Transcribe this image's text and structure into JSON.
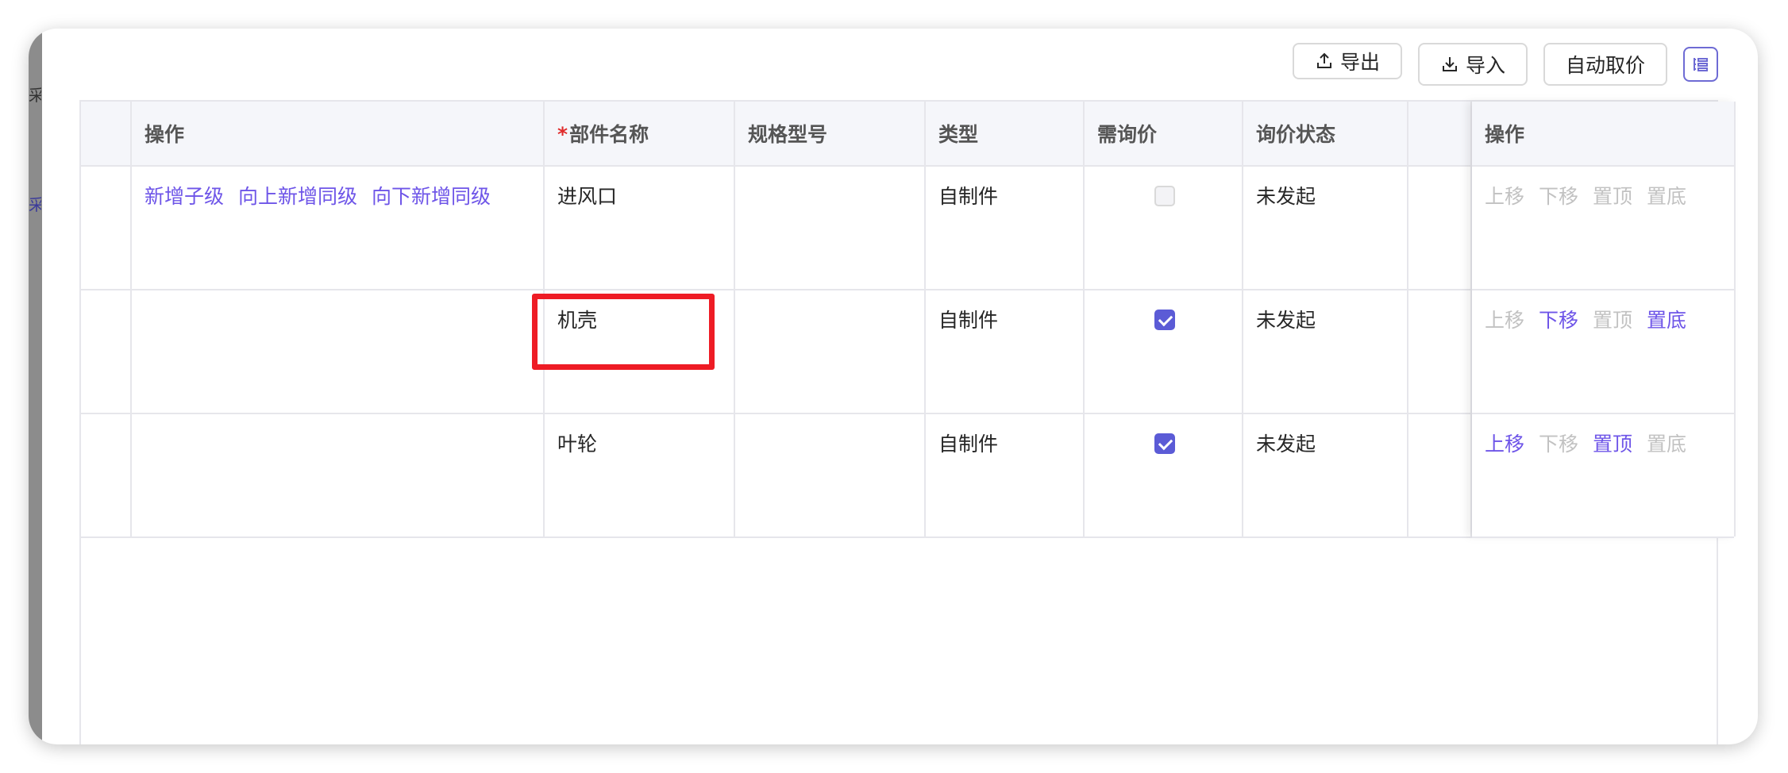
{
  "toolbar": {
    "export_label": "导出",
    "import_label": "导入",
    "auto_price_label": "自动取价"
  },
  "left_fragments": [
    "采",
    "采"
  ],
  "table": {
    "headers": {
      "actions": "操作",
      "required_mark": "*",
      "part_name": "部件名称",
      "spec": "规格型号",
      "type": "类型",
      "need_quote": "需询价",
      "quote_status": "询价状态",
      "op": "操作"
    },
    "row_actions": {
      "add_child": "新增子级",
      "add_above": "向上新增同级",
      "add_below": "向下新增同级"
    },
    "rows": [
      {
        "name": "进风口",
        "spec": "",
        "type": "自制件",
        "need_quote": false,
        "status": "未发起",
        "ops": [
          {
            "label": "上移",
            "enabled": false
          },
          {
            "label": "下移",
            "enabled": false
          },
          {
            "label": "置顶",
            "enabled": false
          },
          {
            "label": "置底",
            "enabled": false
          }
        ]
      },
      {
        "name": "机壳",
        "spec": "",
        "type": "自制件",
        "need_quote": true,
        "status": "未发起",
        "ops": [
          {
            "label": "上移",
            "enabled": false
          },
          {
            "label": "下移",
            "enabled": true
          },
          {
            "label": "置顶",
            "enabled": false
          },
          {
            "label": "置底",
            "enabled": true
          }
        ]
      },
      {
        "name": "叶轮",
        "spec": "",
        "type": "自制件",
        "need_quote": true,
        "status": "未发起",
        "ops": [
          {
            "label": "上移",
            "enabled": true
          },
          {
            "label": "下移",
            "enabled": false
          },
          {
            "label": "置顶",
            "enabled": true
          },
          {
            "label": "置底",
            "enabled": false
          }
        ]
      }
    ]
  },
  "colors": {
    "accent": "#6e55e8",
    "checkbox": "#5b5bd6",
    "highlight": "#ee1c25",
    "disabled": "#c2c2c2"
  }
}
